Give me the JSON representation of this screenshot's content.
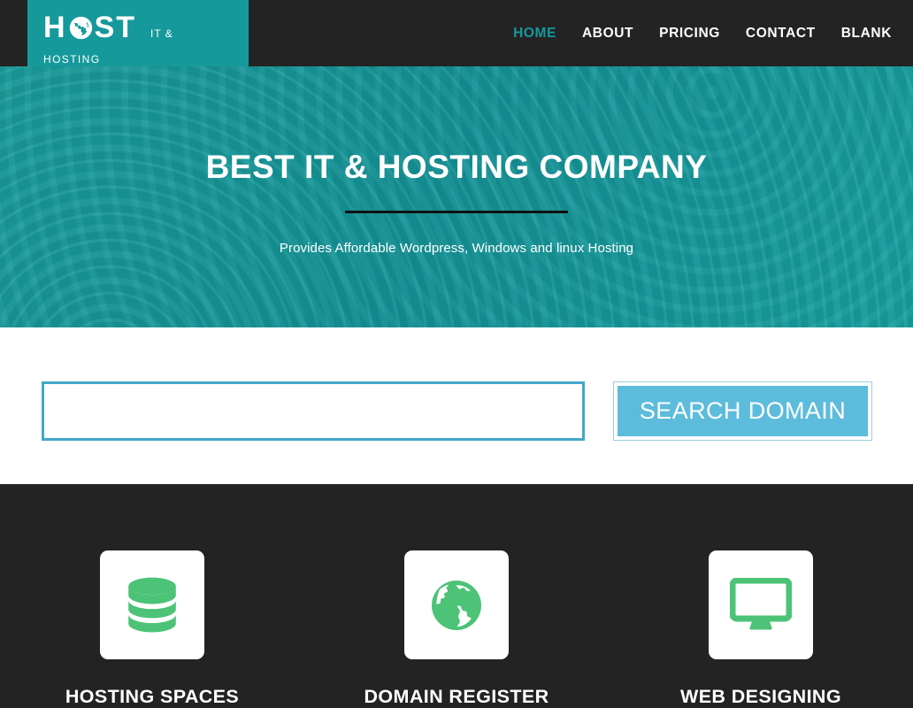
{
  "header": {
    "logo": {
      "text_h": "H",
      "text_st": "ST",
      "globe_icon": "globe-icon",
      "suffix": "IT &",
      "line2": "HOSTING"
    },
    "nav": [
      {
        "label": "HOME",
        "active": true
      },
      {
        "label": "ABOUT",
        "active": false
      },
      {
        "label": "PRICING",
        "active": false
      },
      {
        "label": "CONTACT",
        "active": false
      },
      {
        "label": "BLANK",
        "active": false
      }
    ]
  },
  "hero": {
    "title": "BEST IT & HOSTING COMPANY",
    "subtitle": "Provides Affordable Wordpress, Windows and linux Hosting"
  },
  "search": {
    "value": "",
    "placeholder": "",
    "button_label": "SEARCH DOMAIN"
  },
  "services": [
    {
      "icon": "database-icon",
      "title": "HOSTING SPACES"
    },
    {
      "icon": "globe-icon",
      "title": "DOMAIN REGISTER"
    },
    {
      "icon": "desktop-monitor-icon",
      "title": "WEB DESIGNING"
    }
  ],
  "colors": {
    "teal": "#16999b",
    "dark": "#232323",
    "button_blue": "#5dbcdb",
    "input_border": "#42a8c8",
    "icon_green": "#4cc376"
  }
}
